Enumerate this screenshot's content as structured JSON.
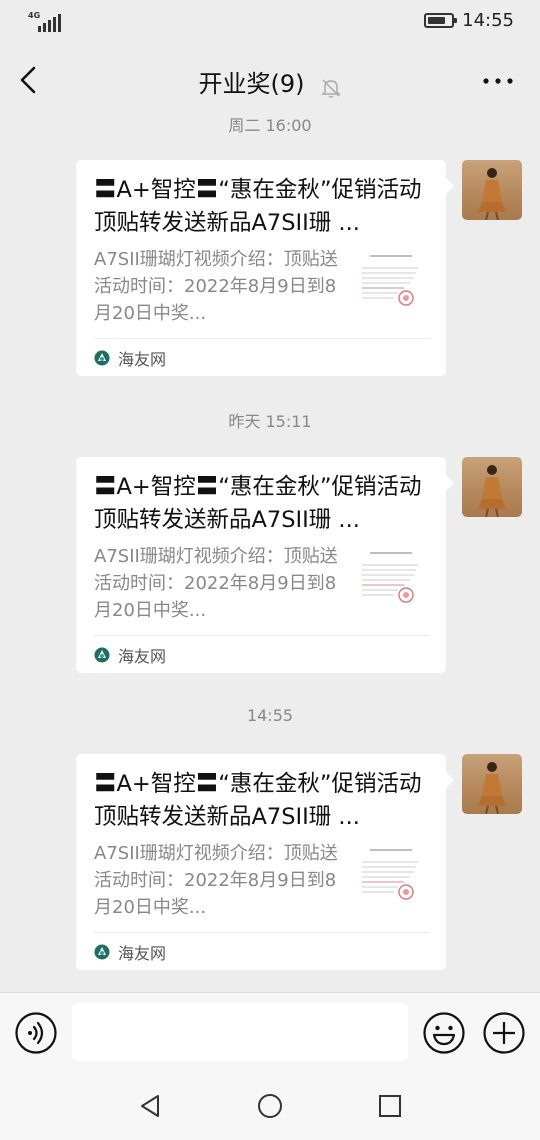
{
  "status_bar": {
    "network": "4G",
    "time": "14:55",
    "battery_level": 0.75
  },
  "header": {
    "title": "开业奖(9)",
    "icons": {
      "back": "back-arrow-icon",
      "mute": "bell-off-icon",
      "more": "more-dots-icon"
    }
  },
  "chat": {
    "messages": [
      {
        "timestamp": "周二 16:00",
        "title": "〓A+智控〓“惠在金秋”促销活动顶贴转发送新品A7SII珊 ...",
        "description": "A7SII珊瑚灯视频介绍：顶贴送活动时间：2022年8月9日到8月20日中奖...",
        "source": "海友网"
      },
      {
        "timestamp": "昨天 15:11",
        "title": "〓A+智控〓“惠在金秋”促销活动顶贴转发送新品A7SII珊 ...",
        "description": "A7SII珊瑚灯视频介绍：顶贴送活动时间：2022年8月9日到8月20日中奖...",
        "source": "海友网"
      },
      {
        "timestamp": "14:55",
        "title": "〓A+智控〓“惠在金秋”促销活动顶贴转发送新品A7SII珊 ...",
        "description": "A7SII珊瑚灯视频介绍：顶贴送活动时间：2022年8月9日到8月20日中奖...",
        "source": "海友网"
      }
    ]
  },
  "input_bar": {
    "text_value": "",
    "icons": {
      "voice": "voice-icon",
      "emoji": "emoji-icon",
      "plus": "plus-icon"
    }
  },
  "system_nav": {
    "icons": {
      "back": "nav-back-icon",
      "home": "nav-home-icon",
      "recent": "nav-recent-icon"
    }
  }
}
